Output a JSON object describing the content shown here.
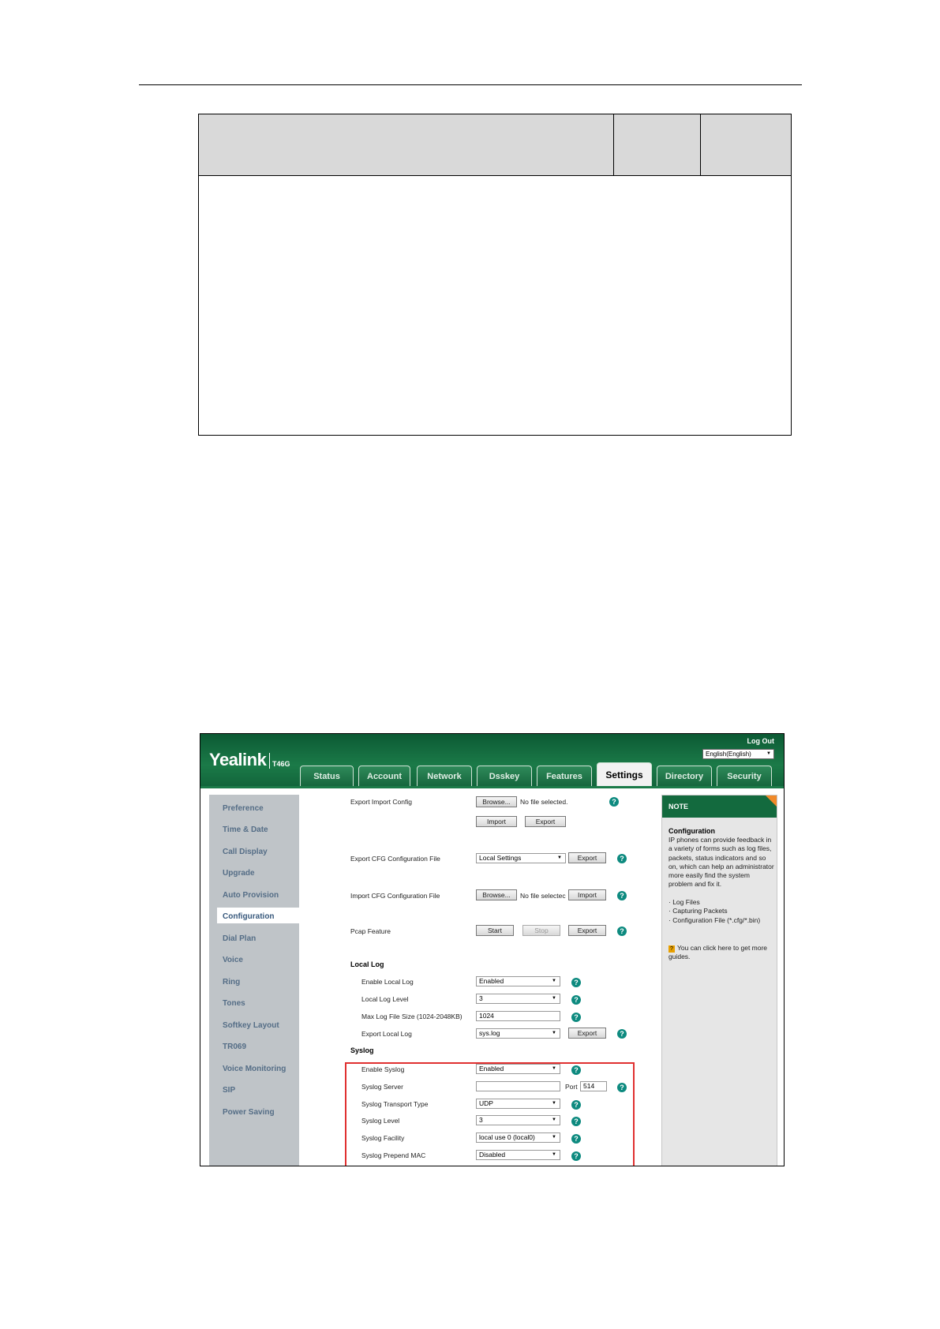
{
  "device": {
    "brand": "Yealink",
    "model": "T46G",
    "logout": "Log Out",
    "language": "English(English)"
  },
  "tabs": [
    "Status",
    "Account",
    "Network",
    "Dsskey",
    "Features",
    "Settings",
    "Directory",
    "Security"
  ],
  "active_tab": "Settings",
  "sidebar": {
    "items": [
      "Preference",
      "Time & Date",
      "Call Display",
      "Upgrade",
      "Auto Provision",
      "Configuration",
      "Dial Plan",
      "Voice",
      "Ring",
      "Tones",
      "Softkey Layout",
      "TR069",
      "Voice Monitoring",
      "SIP",
      "Power Saving"
    ],
    "active": "Configuration"
  },
  "config": {
    "export_import": {
      "label": "Export Import Config",
      "browse": "Browse...",
      "no_file": "No file selected.",
      "import": "Import",
      "export": "Export"
    },
    "export_cfg": {
      "label": "Export CFG Configuration File",
      "value": "Local Settings",
      "export": "Export"
    },
    "import_cfg": {
      "label": "Import CFG Configuration File",
      "browse": "Browse...",
      "no_file": "No file selectec",
      "import": "Import"
    },
    "pcap": {
      "label": "Pcap Feature",
      "start": "Start",
      "stop": "Stop",
      "export": "Export"
    }
  },
  "local_log": {
    "title": "Local Log",
    "enable_label": "Enable Local Log",
    "enable_value": "Enabled",
    "level_label": "Local Log Level",
    "level_value": "3",
    "size_label": "Max Log File Size (1024-2048KB)",
    "size_value": "1024",
    "export_label": "Export Local Log",
    "export_value": "sys.log",
    "export_button": "Export"
  },
  "syslog": {
    "title": "Syslog",
    "enable_label": "Enable Syslog",
    "enable_value": "Enabled",
    "server_label": "Syslog Server",
    "server_value": "",
    "port_label": "Port",
    "port_value": "514",
    "transport_label": "Syslog Transport Type",
    "transport_value": "UDP",
    "level_label": "Syslog Level",
    "level_value": "3",
    "facility_label": "Syslog Facility",
    "facility_value": "local use 0 (local0)",
    "mac_label": "Syslog Prepend MAC",
    "mac_value": "Disabled"
  },
  "note": {
    "header": "NOTE",
    "title": "Configuration",
    "body": "IP phones can provide feedback in a variety of forms such as log files, packets, status indicators and so on, which can help an administrator more easily find the system problem and fix it.",
    "bullets": [
      "Log Files",
      "Capturing Packets",
      "Configuration File (*.cfg/*.bin)"
    ],
    "guide": "You can click here to get more guides."
  },
  "icons": {
    "help": "help-icon",
    "dropdown": "dropdown-arrow-icon",
    "note_corner": "note-corner-icon",
    "guide": "guide-icon"
  },
  "colors": {
    "brand_green": "#136a3e",
    "help_teal": "#0d8a7f",
    "highlight_red": "#e03030",
    "note_orange": "#f08a2a"
  }
}
